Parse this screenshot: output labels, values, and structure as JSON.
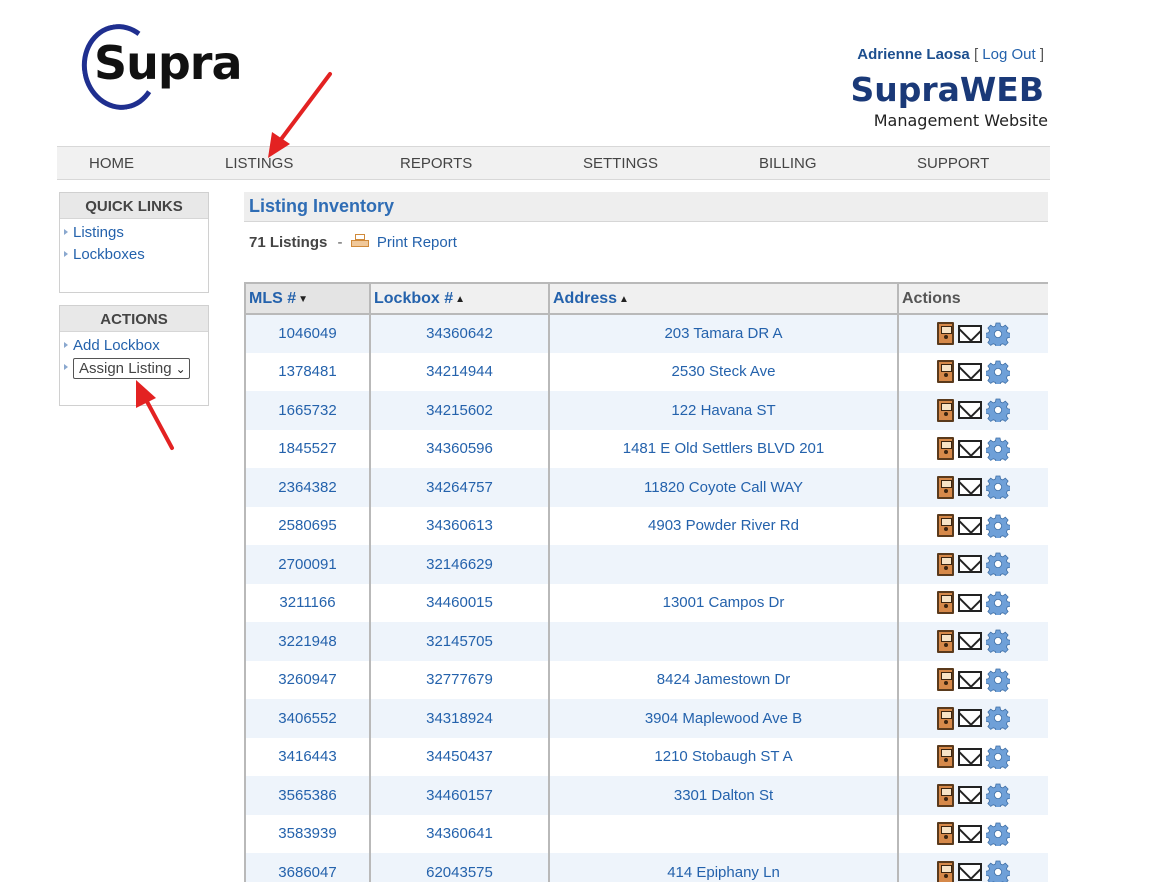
{
  "header": {
    "logo_text": "Supra",
    "user_name": "Adrienne Laosa",
    "logout_label": "Log Out",
    "brand_title": "SupraWEB",
    "brand_subtitle": "Management Website"
  },
  "nav": {
    "items": [
      "HOME",
      "LISTINGS",
      "REPORTS",
      "SETTINGS",
      "BILLING",
      "SUPPORT"
    ]
  },
  "sidebar": {
    "quick_links_title": "QUICK LINKS",
    "quick_links": [
      "Listings",
      "Lockboxes"
    ],
    "actions_title": "ACTIONS",
    "add_lockbox_label": "Add Lockbox",
    "assign_select_value": "Assign Listing"
  },
  "main": {
    "title": "Listing Inventory",
    "count_label": "71 Listings",
    "print_label": "Print Report",
    "columns": [
      "MLS #",
      "Lockbox #",
      "Address",
      "Actions"
    ],
    "rows": [
      {
        "mls": "1046049",
        "lockbox": "34360642",
        "address": "203 Tamara DR A"
      },
      {
        "mls": "1378481",
        "lockbox": "34214944",
        "address": "2530 Steck Ave"
      },
      {
        "mls": "1665732",
        "lockbox": "34215602",
        "address": "122 Havana ST"
      },
      {
        "mls": "1845527",
        "lockbox": "34360596",
        "address": "1481 E Old Settlers BLVD 201"
      },
      {
        "mls": "2364382",
        "lockbox": "34264757",
        "address": "11820 Coyote Call WAY"
      },
      {
        "mls": "2580695",
        "lockbox": "34360613",
        "address": "4903 Powder River Rd"
      },
      {
        "mls": "2700091",
        "lockbox": "32146629",
        "address": ""
      },
      {
        "mls": "3211166",
        "lockbox": "34460015",
        "address": "13001 Campos Dr"
      },
      {
        "mls": "3221948",
        "lockbox": "32145705",
        "address": ""
      },
      {
        "mls": "3260947",
        "lockbox": "32777679",
        "address": "8424 Jamestown Dr"
      },
      {
        "mls": "3406552",
        "lockbox": "34318924",
        "address": "3904 Maplewood Ave B"
      },
      {
        "mls": "3416443",
        "lockbox": "34450437",
        "address": "1210 Stobaugh ST A"
      },
      {
        "mls": "3565386",
        "lockbox": "34460157",
        "address": "3301 Dalton St"
      },
      {
        "mls": "3583939",
        "lockbox": "34360641",
        "address": ""
      },
      {
        "mls": "3686047",
        "lockbox": "62043575",
        "address": "414 Epiphany Ln"
      }
    ],
    "row_action_icons": [
      "lockbox-door-icon",
      "mail-icon",
      "gear-icon"
    ]
  },
  "colors": {
    "link": "#2462ac",
    "title": "#2f6db5",
    "brand": "#1a3978",
    "row_alt": "#eef4fb",
    "annotation": "#e32222"
  }
}
